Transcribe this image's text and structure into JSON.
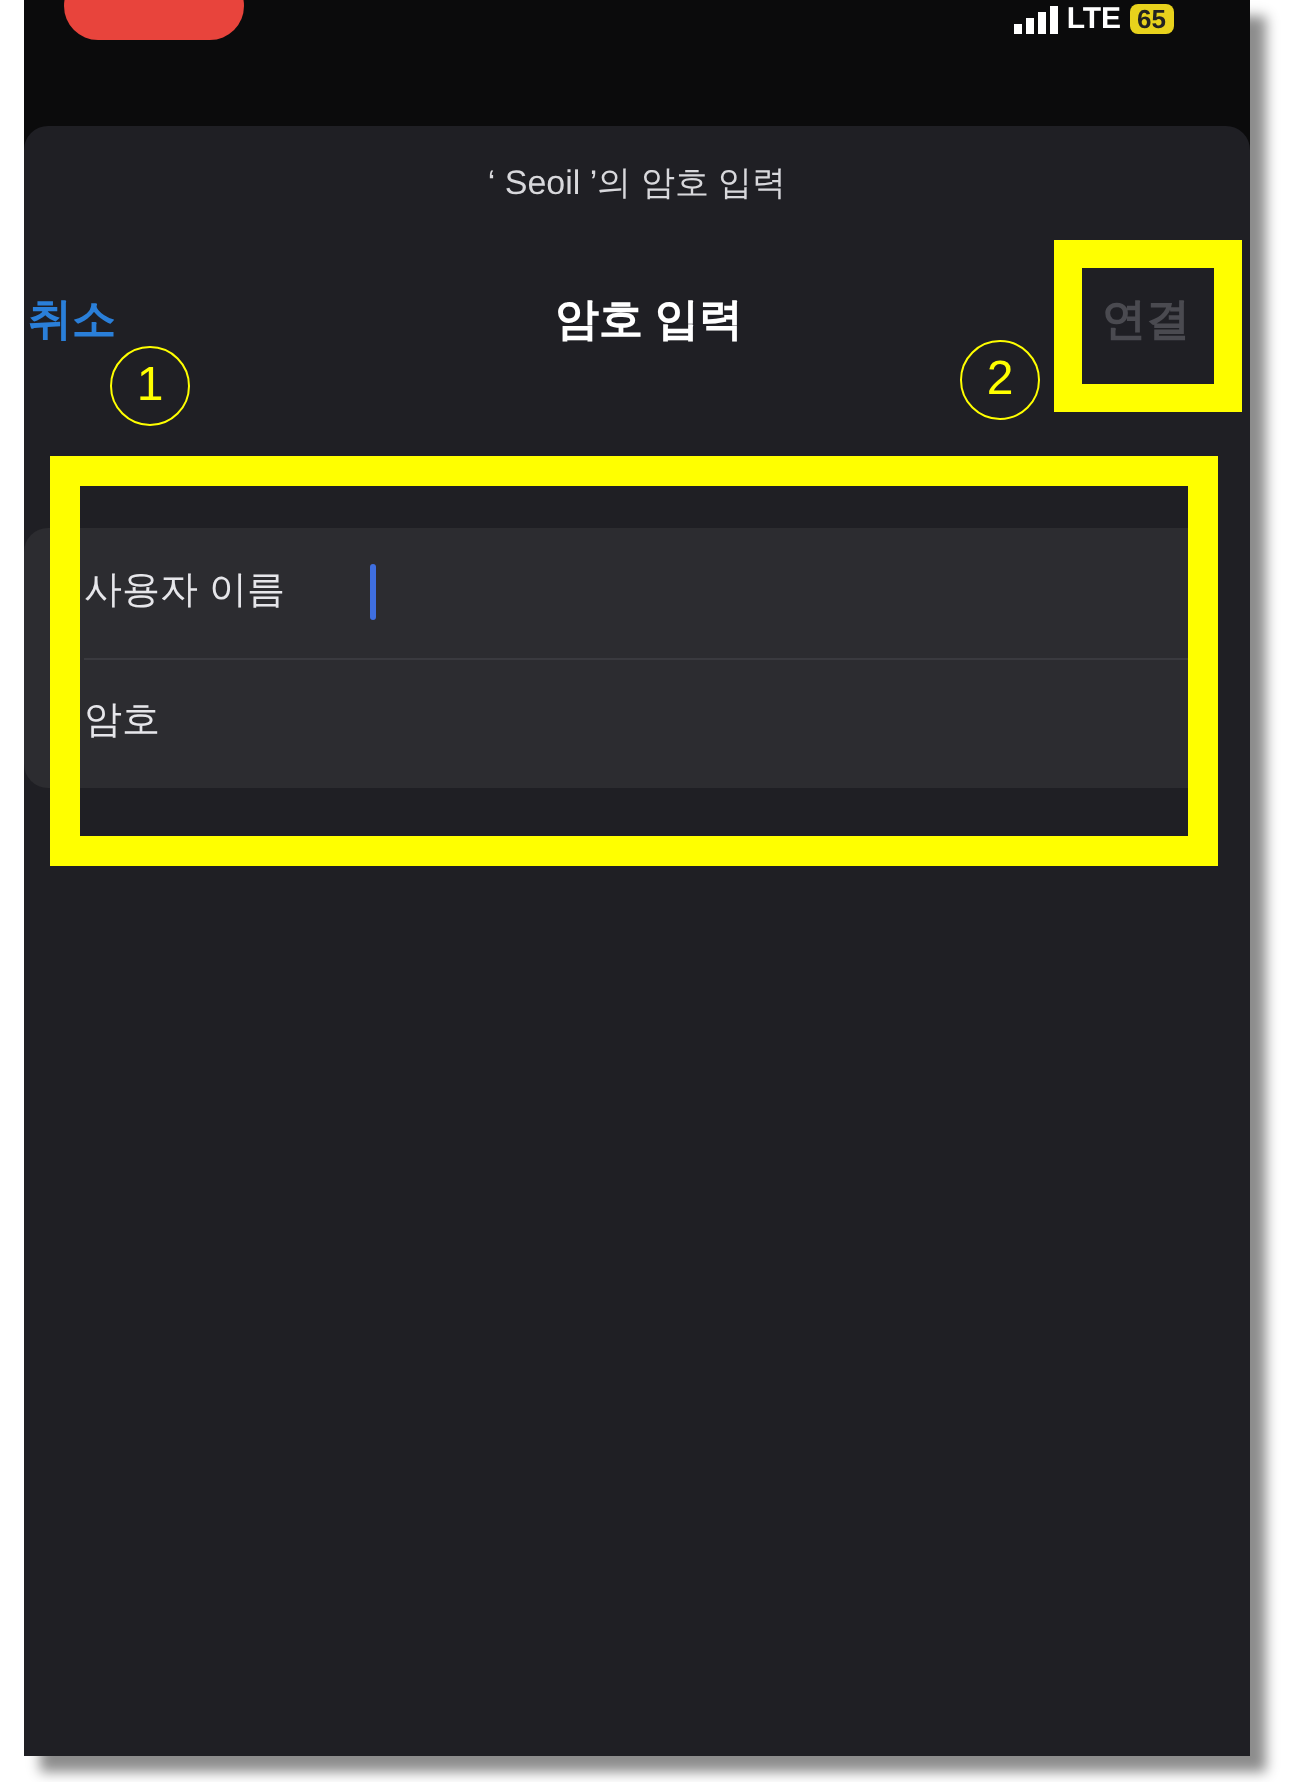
{
  "status_bar": {
    "network": "LTE",
    "battery": "65"
  },
  "sheet": {
    "subtitle": "‘ Seoil ’의 암호 입력",
    "title": "암호 입력",
    "cancel": "취소",
    "connect": {
      "label": "연결",
      "disabled": true
    }
  },
  "fields": [
    {
      "label": "사용자 이름",
      "focused": true
    },
    {
      "label": "암호",
      "focused": false
    }
  ],
  "annotations": [
    {
      "label": "1"
    },
    {
      "label": "2"
    }
  ]
}
